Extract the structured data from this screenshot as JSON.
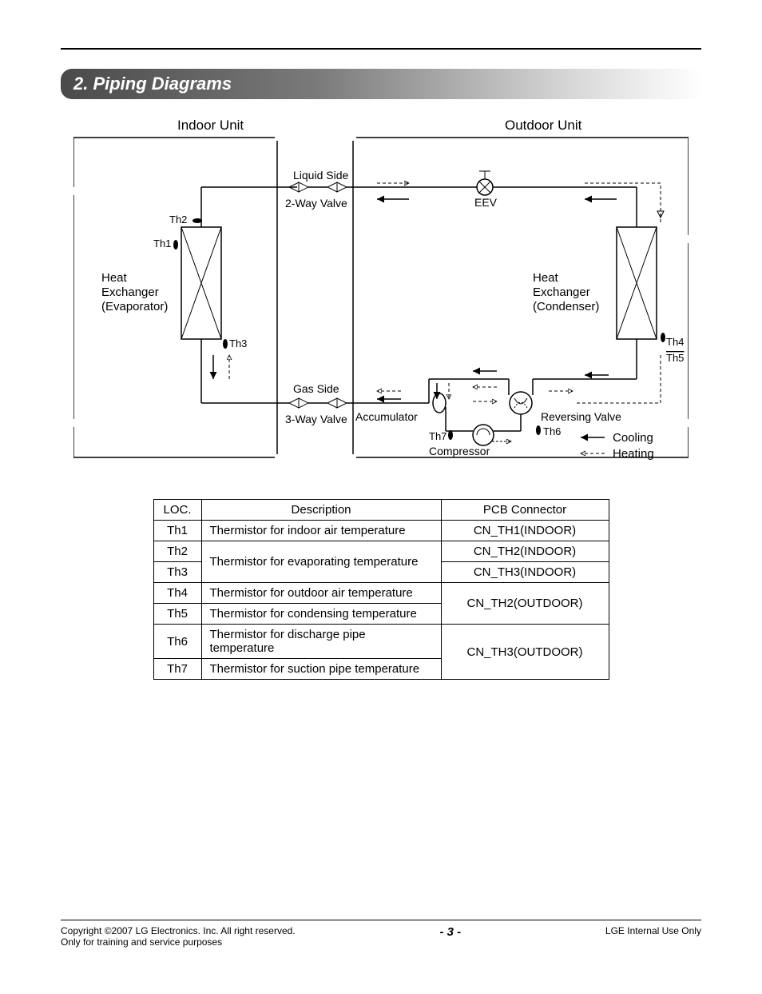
{
  "section_title": "2. Piping Diagrams",
  "diagram": {
    "indoor_unit": "Indoor Unit",
    "outdoor_unit": "Outdoor Unit",
    "liquid_side": "Liquid Side",
    "two_way_valve": "2-Way Valve",
    "gas_side": "Gas Side",
    "three_way_valve": "3-Way Valve",
    "eev": "EEV",
    "heat_exchanger_evap_l1": "Heat",
    "heat_exchanger_evap_l2": "Exchanger",
    "heat_exchanger_evap_l3": "(Evaporator)",
    "heat_exchanger_cond_l1": "Heat",
    "heat_exchanger_cond_l2": "Exchanger",
    "heat_exchanger_cond_l3": "(Condenser)",
    "accumulator": "Accumulator",
    "reversing_valve": "Reversing Valve",
    "compressor": "Compressor",
    "th1": "Th1",
    "th2": "Th2",
    "th3": "Th3",
    "th4": "Th4",
    "th5": "Th5",
    "th6": "Th6",
    "th7": "Th7",
    "cooling": "Cooling",
    "heating": "Heating"
  },
  "table": {
    "headers": {
      "loc": "LOC.",
      "desc": "Description",
      "pcb": "PCB Connector"
    },
    "rows": [
      {
        "loc": "Th1",
        "desc": "Thermistor for indoor air temperature",
        "pcb": "CN_TH1(INDOOR)"
      },
      {
        "loc": "Th2",
        "desc": "Thermistor for evaporating temperature",
        "pcb": "CN_TH2(INDOOR)"
      },
      {
        "loc": "Th3",
        "desc": "Thermistor for evaporating temperature",
        "pcb": "CN_TH3(INDOOR)"
      },
      {
        "loc": "Th4",
        "desc": "Thermistor for outdoor air temperature",
        "pcb": "CN_TH2(OUTDOOR)"
      },
      {
        "loc": "Th5",
        "desc": "Thermistor for condensing temperature",
        "pcb": "CN_TH2(OUTDOOR)"
      },
      {
        "loc": "Th6",
        "desc": "Thermistor for discharge pipe temperature",
        "pcb": "CN_TH3(OUTDOOR)"
      },
      {
        "loc": "Th7",
        "desc": "Thermistor for suction pipe temperature",
        "pcb": "CN_TH3(OUTDOOR)"
      }
    ]
  },
  "footer": {
    "copyright_l1": "Copyright ©2007 LG Electronics. Inc. All right reserved.",
    "copyright_l2": "Only for training and service purposes",
    "page": "- 3 -",
    "right": "LGE Internal Use Only"
  }
}
